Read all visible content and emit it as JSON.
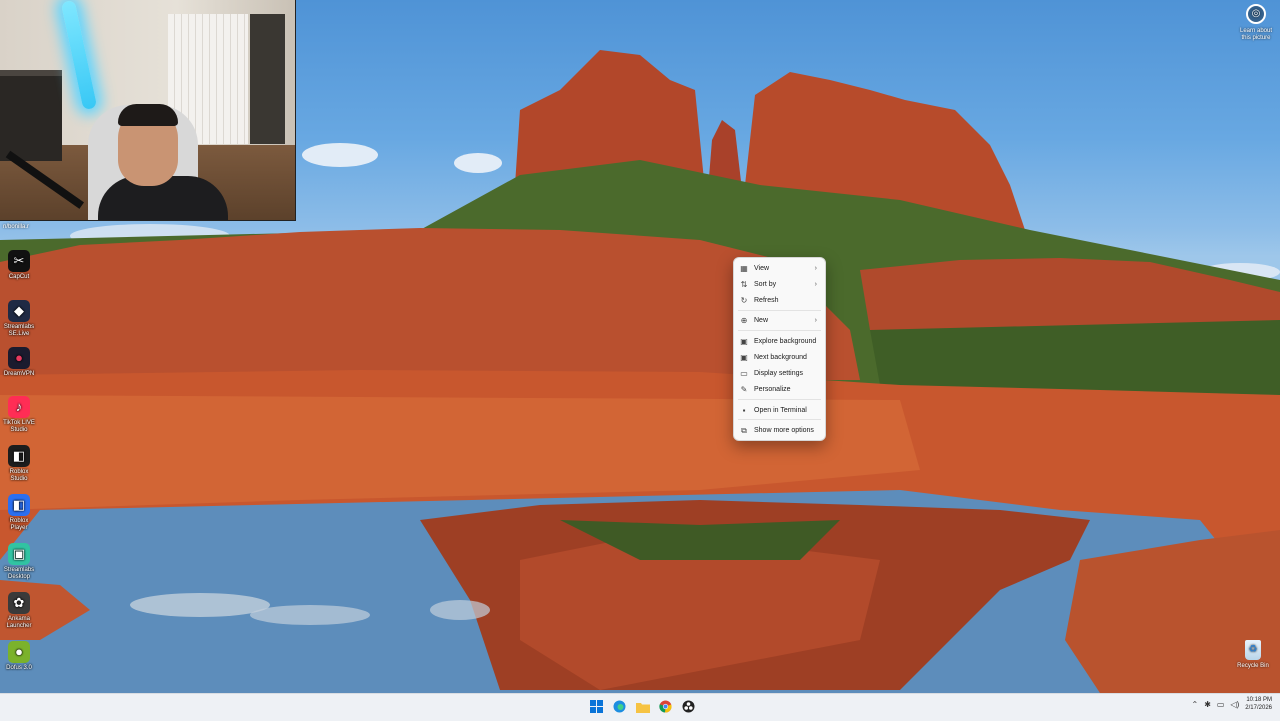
{
  "webcam": {
    "label": "n/bonilla.r"
  },
  "desktop_icons": [
    {
      "label": "CapCut",
      "icon": "capcut-icon",
      "color": "#111111"
    },
    {
      "label": "Streamlabs SE.Live",
      "icon": "streamelements-icon",
      "color": "#1f2a44"
    },
    {
      "label": "DreamVPN",
      "icon": "vpn-icon",
      "color": "#1b1b2e"
    },
    {
      "label": "TikTok LIVE Studio",
      "icon": "tiktok-icon",
      "color": "#ff2d55"
    },
    {
      "label": "Roblox Studio",
      "icon": "roblox-studio-icon",
      "color": "#1d1d1d"
    },
    {
      "label": "Roblox Player",
      "icon": "roblox-player-icon",
      "color": "#2b6ff0"
    },
    {
      "label": "Streamlabs Desktop",
      "icon": "streamlabs-icon",
      "color": "#31c3a2"
    },
    {
      "label": "Ankama Launcher",
      "icon": "ankama-icon",
      "color": "#3a3a3a"
    },
    {
      "label": "Dofus 3.0",
      "icon": "dofus-icon",
      "color": "#7bb22b"
    }
  ],
  "learn": {
    "label": "Learn about this picture",
    "icon": "camera-icon"
  },
  "recycle_bin": {
    "label": "Recycle Bin",
    "icon": "recycle-bin-icon"
  },
  "context_menu": {
    "items": [
      {
        "label": "View",
        "icon": "grid-icon",
        "submenu": true
      },
      {
        "label": "Sort by",
        "icon": "sort-icon",
        "submenu": true
      },
      {
        "label": "Refresh",
        "icon": "refresh-icon",
        "submenu": false
      },
      {
        "label": "New",
        "icon": "plus-icon",
        "submenu": true
      },
      {
        "label": "Explore background",
        "icon": "image-icon",
        "submenu": false
      },
      {
        "label": "Next background",
        "icon": "next-image-icon",
        "submenu": false
      },
      {
        "label": "Display settings",
        "icon": "display-icon",
        "submenu": false
      },
      {
        "label": "Personalize",
        "icon": "brush-icon",
        "submenu": false
      },
      {
        "label": "Open in Terminal",
        "icon": "terminal-icon",
        "submenu": false
      },
      {
        "label": "Show more options",
        "icon": "more-options-icon",
        "submenu": false
      }
    ]
  },
  "taskbar": {
    "apps": [
      {
        "name": "start",
        "icon": "windows-icon"
      },
      {
        "name": "edge",
        "icon": "edge-icon"
      },
      {
        "name": "file-explorer",
        "icon": "folder-icon"
      },
      {
        "name": "chrome",
        "icon": "chrome-icon"
      },
      {
        "name": "obs",
        "icon": "obs-icon"
      }
    ],
    "clock": {
      "time": "10:18 PM",
      "date": "2/17/2026"
    }
  }
}
